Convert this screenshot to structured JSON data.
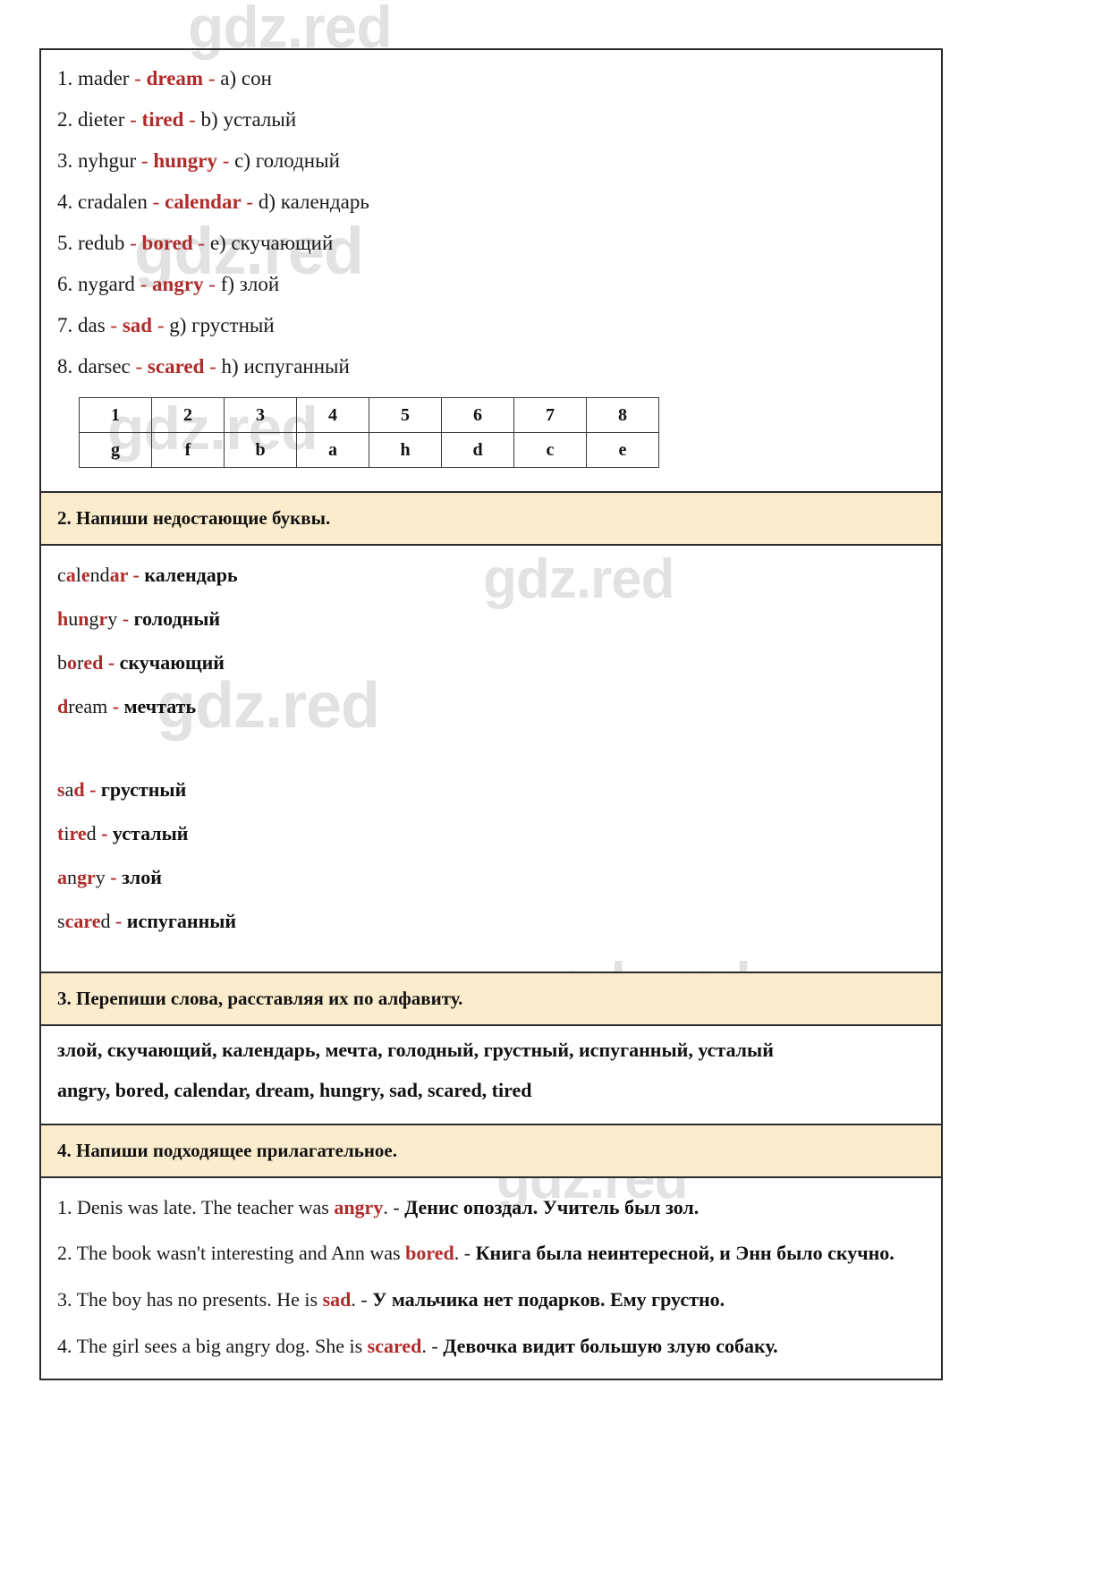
{
  "watermarks": [
    "gdz.red",
    "gdz.red",
    "gdz.red",
    "gdz.red",
    "gdz.red",
    "gdz.red",
    "gdz.red"
  ],
  "task1": {
    "items": [
      {
        "num": "1.",
        "scrambled": "mader",
        "word": "dream",
        "letter": "a)",
        "translation": "сон"
      },
      {
        "num": "2.",
        "scrambled": "dieter",
        "word": "tired",
        "letter": "b)",
        "translation": "усталый"
      },
      {
        "num": "3.",
        "scrambled": "nyhgur",
        "word": "hungry",
        "letter": "c)",
        "translation": "голодный"
      },
      {
        "num": "4.",
        "scrambled": "cradalen",
        "word": "calendar",
        "letter": "d)",
        "translation": "календарь"
      },
      {
        "num": "5.",
        "scrambled": "redub",
        "word": "bored",
        "letter": "e)",
        "translation": "скучающий"
      },
      {
        "num": "6.",
        "scrambled": "nygard",
        "word": "angry",
        "letter": "f)",
        "translation": "злой"
      },
      {
        "num": "7.",
        "scrambled": "das",
        "word": "sad",
        "letter": "g)",
        "translation": "грустный"
      },
      {
        "num": "8.",
        "scrambled": "darsec",
        "word": "scared",
        "letter": "h)",
        "translation": "испуганный"
      }
    ],
    "dash": "-",
    "table": {
      "headers": [
        "1",
        "2",
        "3",
        "4",
        "5",
        "6",
        "7",
        "8"
      ],
      "answers": [
        "g",
        "f",
        "b",
        "a",
        "h",
        "d",
        "c",
        "e"
      ]
    }
  },
  "task2": {
    "heading": "2. Напиши недостающие буквы.",
    "separator": "-",
    "group_a": [
      {
        "word": "calendar",
        "parts": [
          {
            "t": "c",
            "red": false
          },
          {
            "t": "a",
            "red": true
          },
          {
            "t": "l",
            "red": false
          },
          {
            "t": "e",
            "red": true
          },
          {
            "t": "nd",
            "red": false
          },
          {
            "t": "ar",
            "red": true
          }
        ],
        "translation": "календарь"
      },
      {
        "word": "hungry",
        "parts": [
          {
            "t": "h",
            "red": true
          },
          {
            "t": "u",
            "red": false
          },
          {
            "t": "n",
            "red": true
          },
          {
            "t": "g",
            "red": false
          },
          {
            "t": "r",
            "red": true
          },
          {
            "t": "y",
            "red": false
          }
        ],
        "translation": "голодный"
      },
      {
        "word": "bored",
        "parts": [
          {
            "t": "b",
            "red": false
          },
          {
            "t": "o",
            "red": true
          },
          {
            "t": "r",
            "red": false
          },
          {
            "t": "ed",
            "red": true
          }
        ],
        "translation": "скучающий"
      },
      {
        "word": "dream",
        "parts": [
          {
            "t": "d",
            "red": true
          },
          {
            "t": "rea",
            "red": false
          },
          {
            "t": "m",
            "red": false
          }
        ],
        "translation": "мечтать"
      }
    ],
    "group_b": [
      {
        "word": "sad",
        "parts": [
          {
            "t": "s",
            "red": true
          },
          {
            "t": "a",
            "red": false
          },
          {
            "t": "d",
            "red": true
          }
        ],
        "translation": "грустный"
      },
      {
        "word": "tired",
        "parts": [
          {
            "t": "t",
            "red": true
          },
          {
            "t": "i",
            "red": false
          },
          {
            "t": "re",
            "red": true
          },
          {
            "t": "d",
            "red": false
          }
        ],
        "translation": "усталый"
      },
      {
        "word": "angry",
        "parts": [
          {
            "t": "a",
            "red": true
          },
          {
            "t": "n",
            "red": false
          },
          {
            "t": "gr",
            "red": true
          },
          {
            "t": "y",
            "red": false
          }
        ],
        "translation": "злой"
      },
      {
        "word": "scared",
        "parts": [
          {
            "t": "s",
            "red": false
          },
          {
            "t": "c",
            "red": true
          },
          {
            "t": "are",
            "red": true
          },
          {
            "t": "d",
            "red": false
          }
        ],
        "translation": "испуганный"
      }
    ]
  },
  "task3": {
    "heading": "3. Перепиши слова, расставляя их по алфавиту.",
    "line_ru": "злой, скучающий, календарь, мечта, голодный, грустный, испуганный, усталый",
    "line_en": "angry, bored, calendar, dream, hungry, sad, scared, tired"
  },
  "task4": {
    "heading": "4. Напиши подходящее прилагательное.",
    "items": [
      {
        "num": "1.",
        "before": "Denis was late. The teacher was",
        "answer": "angry",
        "after": ".",
        "dash": "-",
        "translation": "Денис опоздал. Учитель был зол."
      },
      {
        "num": "2.",
        "before": "The book wasn't interesting and Ann was",
        "answer": "bored",
        "after": ".",
        "dash": "-",
        "translation": "Книга была неинтересной, и Энн было скучно."
      },
      {
        "num": "3.",
        "before": "The boy has no presents. He is",
        "answer": "sad",
        "after": ".",
        "dash": "-",
        "translation": "У мальчика нет подарков. Ему грустно."
      },
      {
        "num": "4.",
        "before": "The girl sees a big angry dog. She is",
        "answer": "scared",
        "after": ".",
        "dash": "-",
        "translation": "Девочка видит большую злую собаку."
      }
    ]
  },
  "colors": {
    "accent_red": "#b02b2b",
    "section_header_bg": "#fbeccd",
    "border": "#2b2b2b"
  }
}
